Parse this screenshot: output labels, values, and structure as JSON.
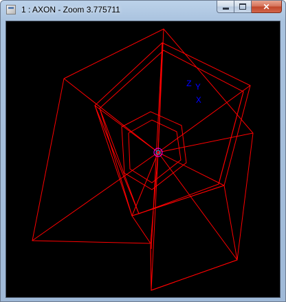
{
  "window": {
    "title": "1 : AXON - Zoom 3.775711",
    "buttons": {
      "minimize": "minimize-icon",
      "maximize": "maximize-icon",
      "close": "close-icon"
    }
  },
  "viewport": {
    "background": "#000000",
    "wire_color": "#ff0000",
    "axis_color": "#0000ff",
    "origin_marker_color": "#ff00ff",
    "axis_labels": {
      "z": "Z",
      "y": "Y",
      "x": "X"
    }
  }
}
